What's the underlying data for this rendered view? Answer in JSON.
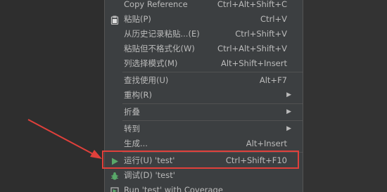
{
  "menu": {
    "items": [
      {
        "label": "Copy Reference",
        "shortcut": "Ctrl+Alt+Shift+C"
      },
      {
        "label": "粘贴(P)",
        "shortcut": "Ctrl+V",
        "icon": "clipboard-icon"
      },
      {
        "label": "从历史记录粘贴...(E)",
        "shortcut": "Ctrl+Shift+V"
      },
      {
        "label": "粘贴但不格式化(W)",
        "shortcut": "Ctrl+Alt+Shift+V"
      },
      {
        "label": "列选择模式(M)",
        "shortcut": "Alt+Shift+Insert"
      },
      {
        "label": "查找使用(U)",
        "shortcut": "Alt+F7"
      },
      {
        "label": "重构(R)",
        "submenu": "▶"
      },
      {
        "label": "折叠",
        "submenu": "▶"
      },
      {
        "label": "转到",
        "submenu": "▶"
      },
      {
        "label": "生成...",
        "shortcut": "Alt+Insert"
      },
      {
        "label": "运行(U) 'test'",
        "shortcut": "Ctrl+Shift+F10",
        "icon": "play-icon"
      },
      {
        "label": "调试(D) 'test'",
        "icon": "debug-icon"
      },
      {
        "label": "Run 'test' with Coverage",
        "icon": "coverage-icon"
      }
    ]
  },
  "colors": {
    "menu_bg": "#3c3f41",
    "text": "#bbbbbb",
    "highlight": "#e0403b",
    "run_icon": "#59a869"
  }
}
